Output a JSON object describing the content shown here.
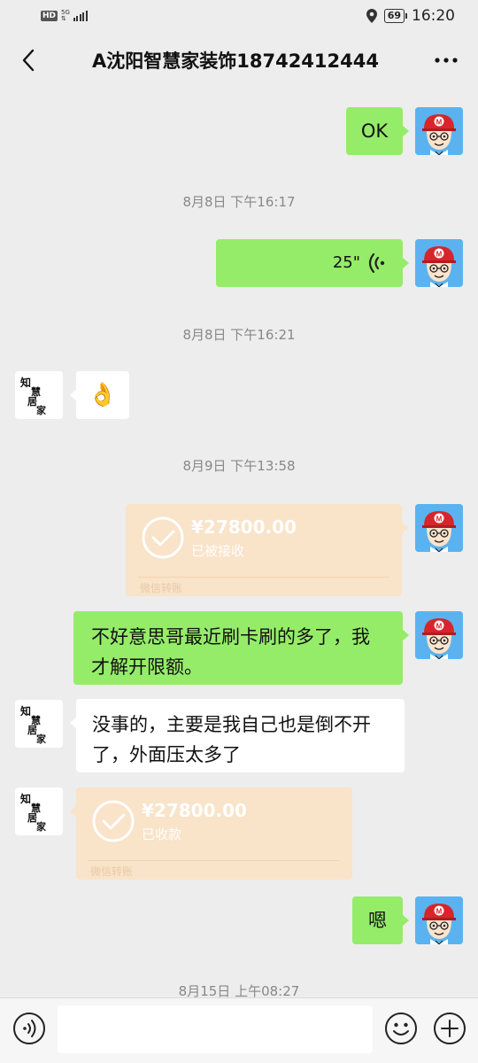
{
  "status_bar": {
    "hd": "HD",
    "network": "5G",
    "battery": "69",
    "time": "16:20"
  },
  "header": {
    "title": "A沈阳智慧家装饰18742412444"
  },
  "messages": [
    {
      "text": "OK"
    },
    {
      "timestamp": "8月8日 下午16:17"
    },
    {
      "voice_duration": "25\""
    },
    {
      "timestamp": "8月8日 下午16:21"
    },
    {
      "emoji": "👌"
    },
    {
      "timestamp": "8月9日 下午13:58"
    },
    {
      "amount": "¥27800.00",
      "status": "已被接收",
      "footer": "微信转账"
    },
    {
      "text": "不好意思哥最近刷卡刷的多了，我才解开限额。"
    },
    {
      "text": "没事的，主要是我自己也是倒不开了，外面压太多了"
    },
    {
      "amount": "¥27800.00",
      "status": "已收款",
      "footer": "微信转账"
    },
    {
      "text": "嗯"
    },
    {
      "timestamp": "8月15日 上午08:27"
    }
  ],
  "icons": {
    "me_avatar": "cartoon-boy-red-cap-avatar",
    "them_avatar": "calligraphy-logo-avatar"
  },
  "colors": {
    "my_bubble": "#95ec69",
    "their_bubble": "#ffffff",
    "transfer_bg": "#fae3c8",
    "background": "#ededed"
  }
}
